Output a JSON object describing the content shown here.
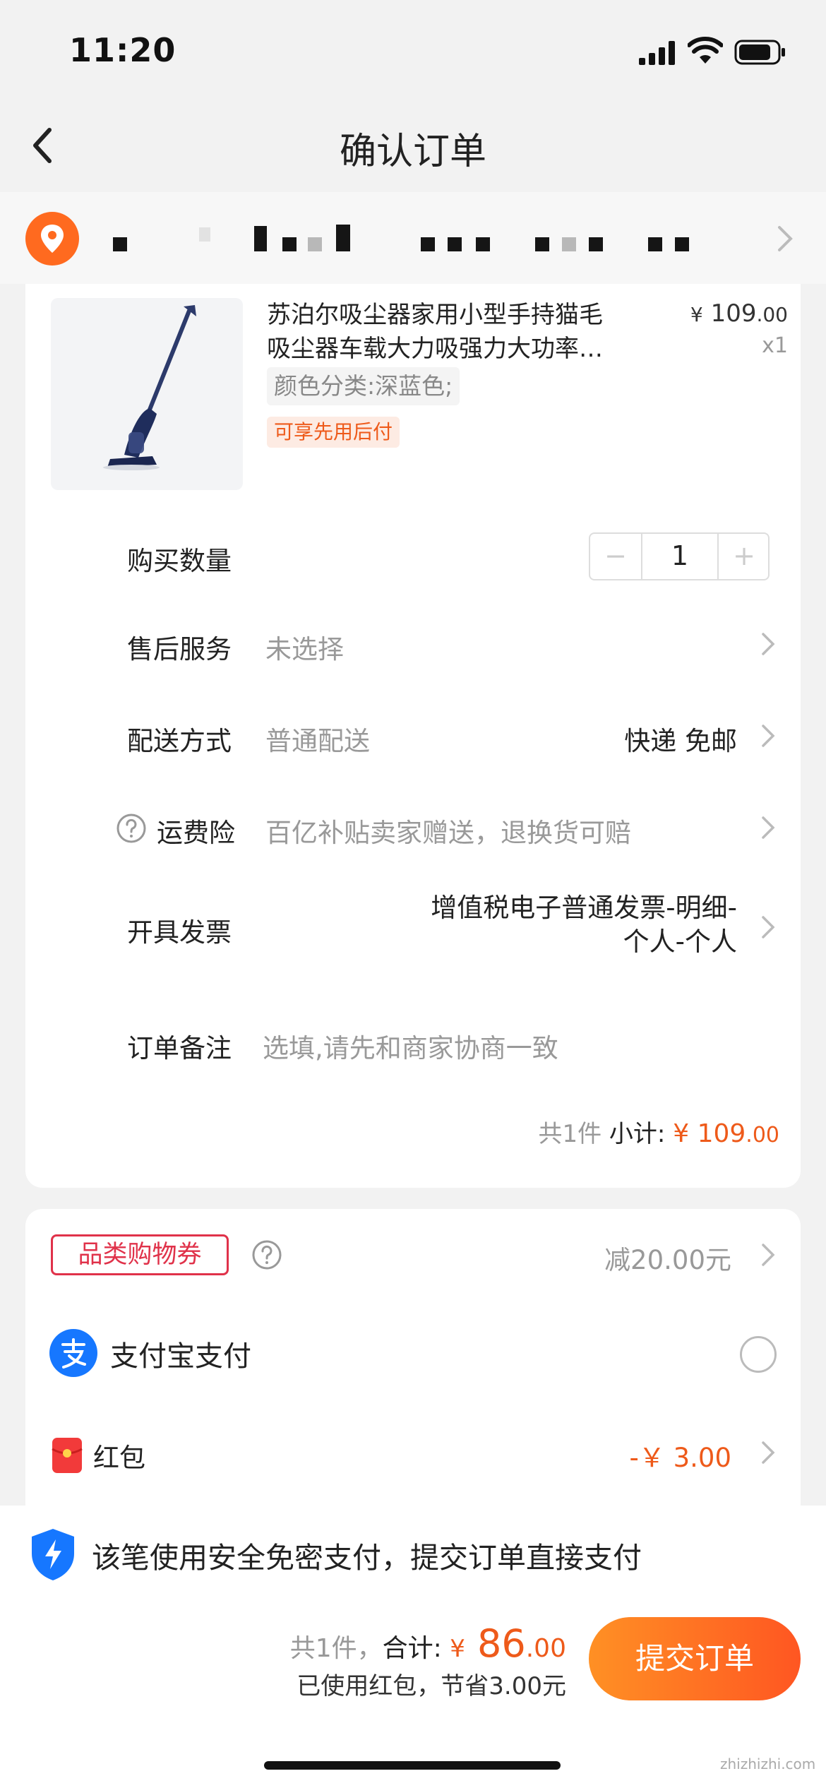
{
  "status_bar": {
    "time": "11:20"
  },
  "nav": {
    "title": "确认订单"
  },
  "product": {
    "name_line1": "苏泊尔吸尘器家用小型手持猫毛",
    "name_line2": "吸尘器车载大力吸强力大功率…",
    "price_symbol": "¥",
    "price_int": "109",
    "price_dec": ".00",
    "qty": "x1",
    "spec": "颜色分类:深蓝色;",
    "tag": "可享先用后付"
  },
  "rows": {
    "quantity": {
      "label": "购买数量",
      "value": "1",
      "minus": "−",
      "plus": "+"
    },
    "after_sale": {
      "label": "售后服务",
      "value": "未选择"
    },
    "delivery": {
      "label": "配送方式",
      "value": "普通配送",
      "right": "快递 免邮"
    },
    "freight_insurance": {
      "label": "运费险",
      "value": "百亿补贴卖家赠送，退换货可赔"
    },
    "invoice": {
      "label": "开具发票",
      "line1": "增值税电子普通发票-明细-",
      "line2": "个人-个人"
    },
    "remark": {
      "label": "订单备注",
      "placeholder": "选填,请先和商家协商一致"
    }
  },
  "subtotal": {
    "count": "共1件",
    "label": "小计:",
    "symbol": "¥",
    "int": "109",
    "dec": ".00"
  },
  "payment": {
    "coupon_label": "品类购物券",
    "coupon_value": "减20.00元",
    "alipay_label": "支付宝支付",
    "hongbao_label": "红包",
    "hongbao_value": "-￥ 3.00"
  },
  "bottom": {
    "safe_msg": "该笔使用安全免密支付，提交订单直接支付",
    "count": "共1件，",
    "total_label": "合计:",
    "symbol": "¥",
    "total_int": "86",
    "total_dec": ".00",
    "saved": "已使用红包，节省3.00元",
    "submit": "提交订单"
  },
  "watermark": "zhizhizhi.com",
  "colors": {
    "accent": "#ee5a1a",
    "coupon_red": "#e0324a",
    "alipay_blue": "#1677ff"
  }
}
